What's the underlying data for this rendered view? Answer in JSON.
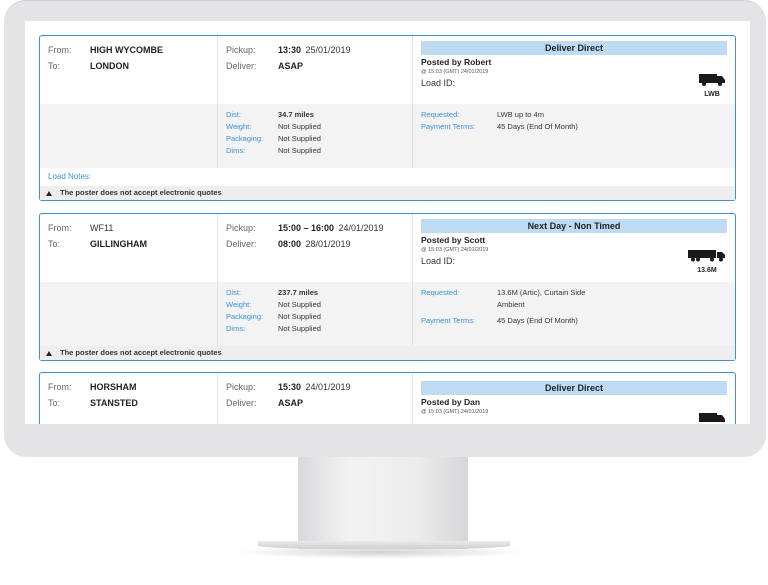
{
  "loads": [
    {
      "from_label": "From:",
      "from": "HIGH WYCOMBE",
      "to_label": "To:",
      "to": "LONDON",
      "pickup_label": "Pickup:",
      "pickup_time": "13:30",
      "pickup_date": "25/01/2019",
      "deliver_label": "Deliver:",
      "deliver_time": "ASAP",
      "deliver_date": "",
      "banner": "Deliver Direct",
      "posted_by": "Posted by Robert",
      "posted_stamp": "@ 15:03 (GMT) 24/01/2019",
      "load_id_label": "Load ID:",
      "vehicle_icon": "van-icon",
      "vehicle_label": "LWB",
      "dist_label": "Dist:",
      "dist": "34.7 miles",
      "weight_label": "Weight:",
      "weight": "Not Supplied",
      "packaging_label": "Packaging:",
      "packaging": "Not Supplied",
      "dims_label": "Dims:",
      "dims": "Not Supplied",
      "requested_label": "Requested:",
      "requested": "LWB up to 4m",
      "requested2": "",
      "payment_label": "Payment Terms:",
      "payment": "45 Days (End Of Month)",
      "notes_label": "Load Notes:",
      "quote_notice": "The poster does not accept electronic quotes"
    },
    {
      "from_label": "From:",
      "from": "WF11",
      "to_label": "To:",
      "to": "GILLINGHAM",
      "pickup_label": "Pickup:",
      "pickup_time": "15:00 – 16:00",
      "pickup_date": "24/01/2019",
      "deliver_label": "Deliver:",
      "deliver_time": "08:00",
      "deliver_date": "28/01/2019",
      "banner": "Next Day - Non Timed",
      "posted_by": "Posted by Scott",
      "posted_stamp": "@ 15:03 (GMT) 24/01/2019",
      "load_id_label": "Load ID:",
      "vehicle_icon": "artic-truck-icon",
      "vehicle_label": "13.6M",
      "dist_label": "Dist:",
      "dist": "237.7 miles",
      "weight_label": "Weight:",
      "weight": "Not Supplied",
      "packaging_label": "Packaging:",
      "packaging": "Not Supplied",
      "dims_label": "Dims:",
      "dims": "Not Supplied",
      "requested_label": "Requested:",
      "requested": "13.6M (Artic), Curtain Side",
      "requested2": "Ambient",
      "payment_label": "Payment Terms:",
      "payment": "45 Days (End Of Month)",
      "quote_notice": "The poster does not accept electronic quotes"
    },
    {
      "from_label": "From:",
      "from": "HORSHAM",
      "to_label": "To:",
      "to": "STANSTED",
      "pickup_label": "Pickup:",
      "pickup_time": "15:30",
      "pickup_date": "24/01/2019",
      "deliver_label": "Deliver:",
      "deliver_time": "ASAP",
      "deliver_date": "",
      "banner": "Deliver Direct",
      "posted_by": "Posted by Dan",
      "posted_stamp": "@ 15:03 (GMT) 24/01/2019",
      "vehicle_icon": "van-icon"
    }
  ]
}
